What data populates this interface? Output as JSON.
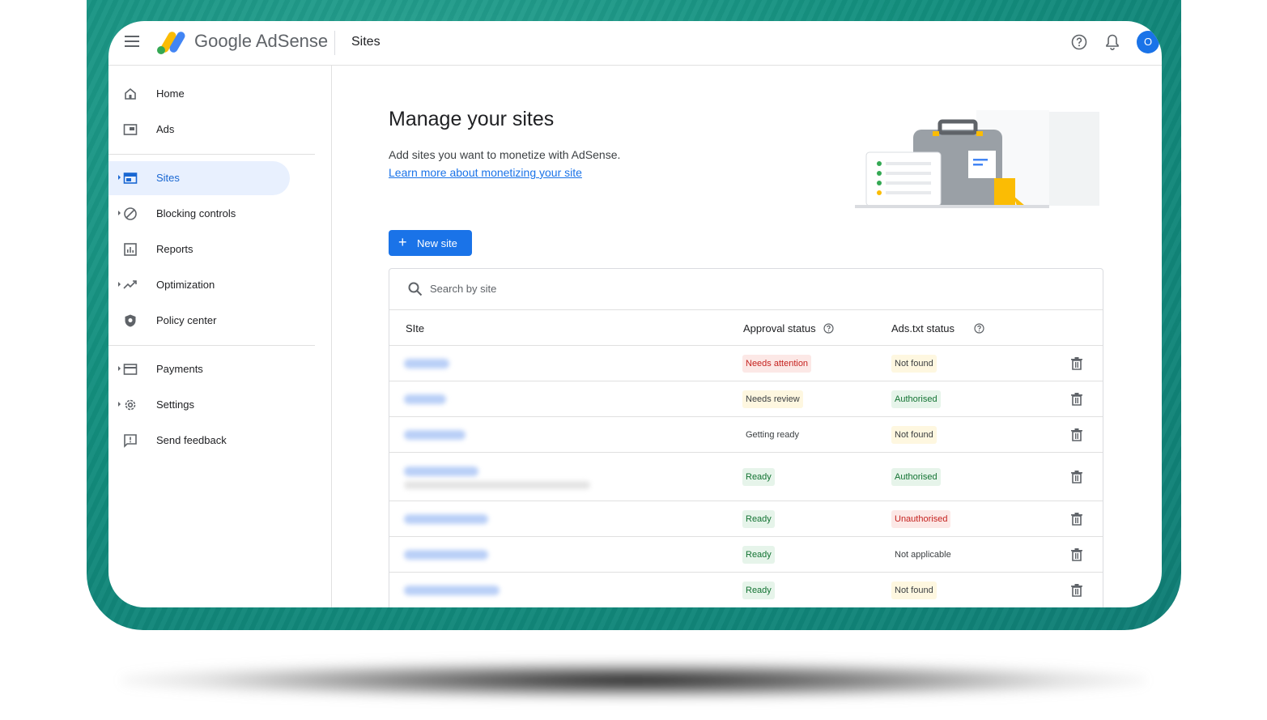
{
  "app": {
    "brand_google": "Google",
    "brand_product": "AdSense",
    "page_title": "Sites",
    "avatar_initial": "O"
  },
  "sidebar": {
    "items": [
      {
        "label": "Home",
        "icon": "home-icon"
      },
      {
        "label": "Ads",
        "icon": "ads-icon"
      },
      {
        "label": "Sites",
        "icon": "sites-icon",
        "active": true
      },
      {
        "label": "Blocking controls",
        "icon": "block-icon"
      },
      {
        "label": "Reports",
        "icon": "reports-icon"
      },
      {
        "label": "Optimization",
        "icon": "trending-icon"
      },
      {
        "label": "Policy center",
        "icon": "shield-icon"
      },
      {
        "label": "Payments",
        "icon": "card-icon"
      },
      {
        "label": "Settings",
        "icon": "gear-icon"
      },
      {
        "label": "Send feedback",
        "icon": "feedback-icon"
      }
    ]
  },
  "main": {
    "heading": "Manage your sites",
    "subtext": "Add sites you want to monetize with AdSense.",
    "learn_link": "Learn more about monetizing your site",
    "new_site_label": "New site",
    "search_placeholder": "Search by site",
    "columns": {
      "site": "SIte",
      "approval": "Approval status",
      "ads_txt": "Ads.txt status"
    },
    "rows": [
      {
        "approval": "Needs attention",
        "ads_txt": "Not found"
      },
      {
        "approval": "Needs review",
        "ads_txt": "Authorised"
      },
      {
        "approval": "Getting ready",
        "ads_txt": "Not found"
      },
      {
        "approval": "Ready",
        "ads_txt": "Authorised"
      },
      {
        "approval": "Ready",
        "ads_txt": "Unauthorised"
      },
      {
        "approval": "Ready",
        "ads_txt": "Not applicable"
      },
      {
        "approval": "Ready",
        "ads_txt": "Not found"
      }
    ]
  },
  "colors": {
    "accent": "#1a73e8",
    "frame": "#14907f",
    "status_red_bg": "#fce8e6",
    "status_yellow_bg": "#fef7e0",
    "status_green_bg": "#e6f4ea"
  }
}
